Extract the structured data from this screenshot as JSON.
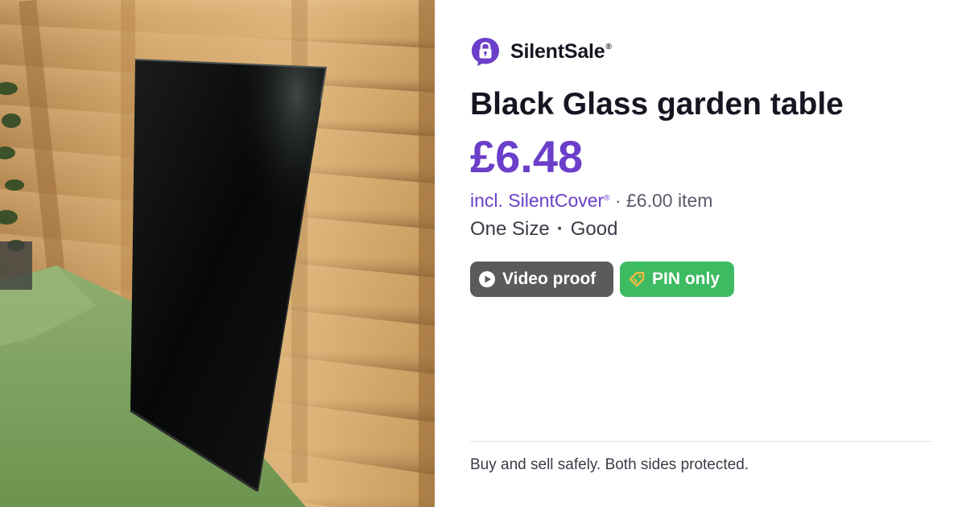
{
  "brand": {
    "name": "SilentSale",
    "reg_mark": "®",
    "logo_icon": "padlock-speech-bubble-icon",
    "color": "#6b3fc9"
  },
  "listing": {
    "title": "Black Glass garden table",
    "price": "£6.48",
    "cover_prefix": "incl. ",
    "cover_name": "SilentCover",
    "cover_reg_mark": "®",
    "item_price_text": " · £6.00 item",
    "size": "One Size",
    "separator": "·",
    "condition": "Good"
  },
  "badges": {
    "video": {
      "label": "Video proof",
      "icon": "play-circle-icon",
      "color": "#5b5b5b"
    },
    "pin": {
      "label": "PIN only",
      "icon": "pin-tag-icon",
      "color": "#3dbb62"
    }
  },
  "footer": {
    "tagline": "Buy and sell safely. Both sides protected."
  },
  "photo": {
    "subject": "product-photo-glass-table-top"
  }
}
